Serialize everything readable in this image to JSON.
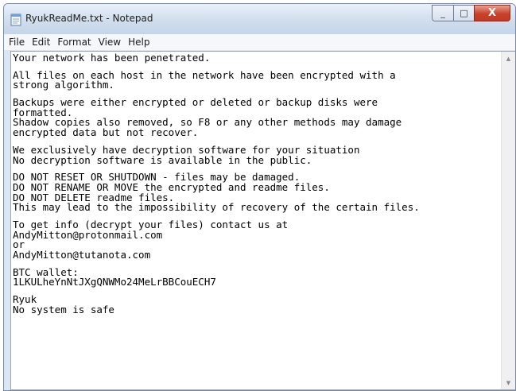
{
  "window": {
    "title": "RyukReadMe.txt - Notepad",
    "icon": "notepad-icon"
  },
  "caption": {
    "minimize_glyph": "_",
    "maximize_glyph": "□",
    "close_glyph": "X"
  },
  "menu": {
    "items": [
      "File",
      "Edit",
      "Format",
      "View",
      "Help"
    ]
  },
  "document": {
    "lines": [
      "Your network has been penetrated.",
      "",
      "All files on each host in the network have been encrypted with a",
      "strong algorithm.",
      "",
      "Backups were either encrypted or deleted or backup disks were",
      "formatted.",
      "Shadow copies also removed, so F8 or any other methods may damage",
      "encrypted data but not recover.",
      "",
      "We exclusively have decryption software for your situation",
      "No decryption software is available in the public.",
      "",
      "DO NOT RESET OR SHUTDOWN - files may be damaged.",
      "DO NOT RENAME OR MOVE the encrypted and readme files.",
      "DO NOT DELETE readme files.",
      "This may lead to the impossibility of recovery of the certain files.",
      "",
      "To get info (decrypt your files) contact us at",
      "AndyMitton@protonmail.com",
      "or",
      "AndyMitton@tutanota.com",
      "",
      "BTC wallet:",
      "1LKULheYnNtJXgQNWMo24MeLrBBCouECH7",
      "",
      "Ryuk",
      "No system is safe"
    ]
  },
  "scrollbar": {
    "up_arrow": "▲",
    "down_arrow": "▼"
  }
}
